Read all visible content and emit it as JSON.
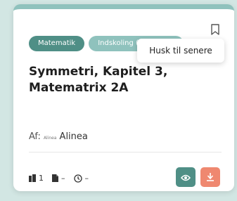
{
  "card": {
    "tags": [
      {
        "label": "Matematik"
      },
      {
        "label": "Indskoling (Fase 1) f..."
      }
    ],
    "bookmark_icon": "bookmark-icon",
    "tooltip": "Husk til senere",
    "title": "Symmetri, Kapitel 3, Matematrix 2A",
    "author": {
      "label": "Af:",
      "logo_text": "Alinea",
      "name": "Alinea"
    },
    "stats": {
      "pages": "1",
      "documents": "–",
      "time": "–"
    },
    "actions": {
      "view_icon": "eye-icon",
      "download_icon": "download-icon"
    },
    "colors": {
      "accent": "#4f8f86",
      "accent_light": "#8fc2bd",
      "download": "#ef8870",
      "background": "#d2e6e3"
    }
  }
}
